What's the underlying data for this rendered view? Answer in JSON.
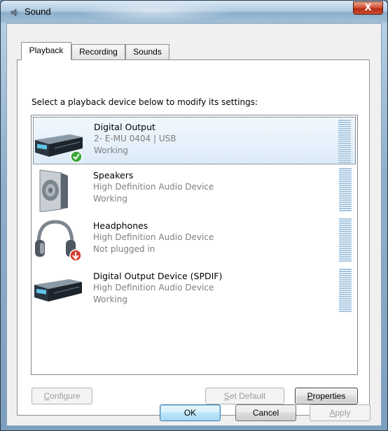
{
  "window": {
    "title": "Sound",
    "close_label": "X"
  },
  "tabs": [
    {
      "label": "Playback",
      "active": true
    },
    {
      "label": "Recording",
      "active": false
    },
    {
      "label": "Sounds",
      "active": false
    }
  ],
  "instruction": "Select a playback device below to modify its settings:",
  "devices": [
    {
      "name": "Digital Output",
      "desc": "2- E-MU 0404 | USB",
      "status": "Working",
      "icon": "digital-output-device-icon",
      "badge": "default-check-icon",
      "selected": true
    },
    {
      "name": "Speakers",
      "desc": "High Definition Audio Device",
      "status": "Working",
      "icon": "speaker-icon",
      "selected": false
    },
    {
      "name": "Headphones",
      "desc": "High Definition Audio Device",
      "status": "Not plugged in",
      "icon": "headphones-icon",
      "badge": "unplugged-arrow-icon",
      "selected": false
    },
    {
      "name": "Digital Output Device (SPDIF)",
      "desc": "High Definition Audio Device",
      "status": "Working",
      "icon": "digital-output-device-icon",
      "selected": false
    }
  ],
  "buttons": {
    "configure": {
      "pre": "",
      "key": "C",
      "post": "onfigure",
      "enabled": false
    },
    "set_default": {
      "pre": "",
      "key": "S",
      "post": "et Default",
      "enabled": false
    },
    "properties": {
      "pre": "",
      "key": "P",
      "post": "roperties",
      "enabled": true
    },
    "ok": "OK",
    "cancel": "Cancel",
    "apply": {
      "pre": "",
      "key": "A",
      "post": "pply",
      "enabled": false
    }
  },
  "colors": {
    "selection": "#dcebf8",
    "meter": "#a7c6df",
    "close": "#c94c2f"
  }
}
